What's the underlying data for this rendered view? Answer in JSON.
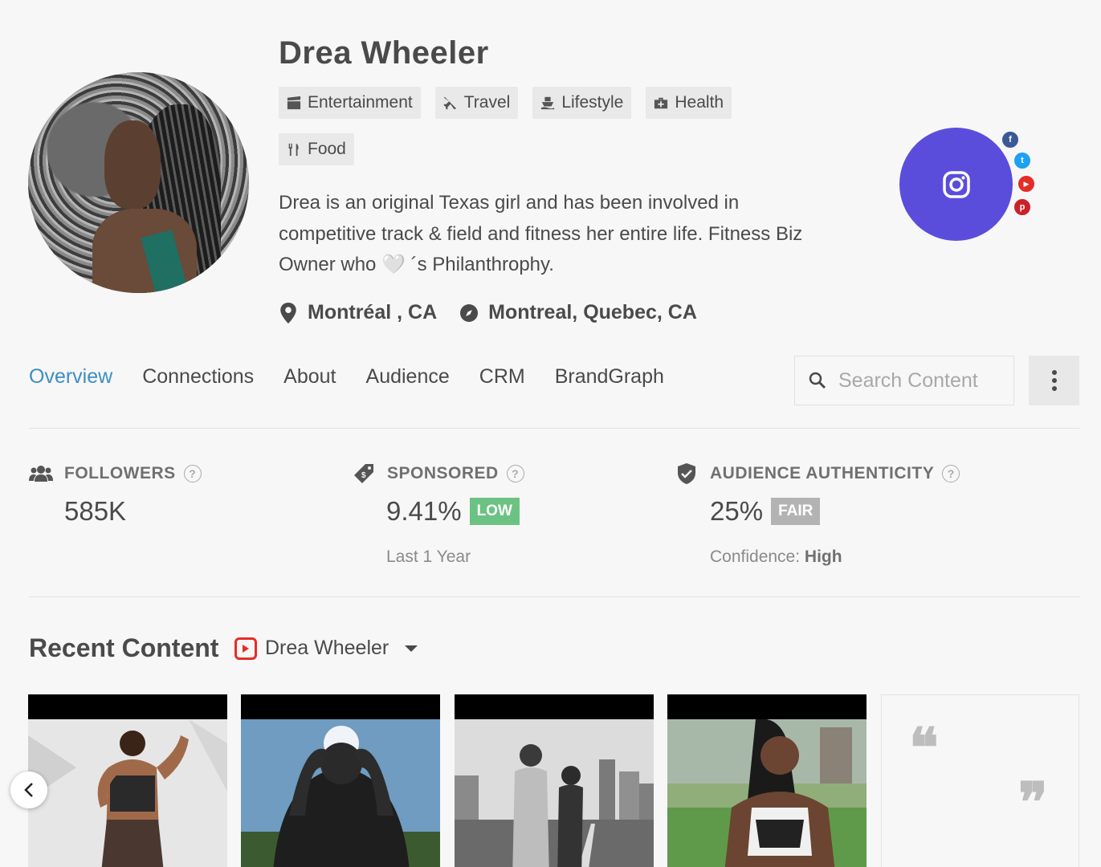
{
  "profile": {
    "name": "Drea Wheeler",
    "tags": [
      {
        "label": "Entertainment",
        "icon": "clapperboard-icon"
      },
      {
        "label": "Travel",
        "icon": "plane-icon"
      },
      {
        "label": "Lifestyle",
        "icon": "ship-icon"
      },
      {
        "label": "Health",
        "icon": "medkit-icon"
      },
      {
        "label": "Food",
        "icon": "utensils-icon"
      }
    ],
    "bio": "Drea is an original Texas girl and has been involved in competitive track & field and fitness her entire life. Fitness Biz Owner who 🤍 ´s Philanthrophy.",
    "location_primary": "Montréal , CA",
    "location_secondary": "Montreal, Quebec, CA"
  },
  "platforms": {
    "main": "instagram-icon",
    "main_color": "#5b4ddb",
    "others": [
      {
        "name": "facebook-icon",
        "glyph": "f",
        "color": "#3b5998"
      },
      {
        "name": "twitter-icon",
        "glyph": "t",
        "color": "#1da1f2"
      },
      {
        "name": "youtube-icon",
        "glyph": "▶",
        "color": "#e52d27"
      },
      {
        "name": "pinterest-icon",
        "glyph": "p",
        "color": "#cb2027"
      }
    ]
  },
  "nav": {
    "tabs": [
      "Overview",
      "Connections",
      "About",
      "Audience",
      "CRM",
      "BrandGraph"
    ],
    "active": "Overview",
    "active_color": "#3d8ec4"
  },
  "search": {
    "placeholder": "Search Content"
  },
  "stats": {
    "followers": {
      "label": "FOLLOWERS",
      "value": "585K"
    },
    "sponsored": {
      "label": "SPONSORED",
      "value": "9.41%",
      "badge": "LOW",
      "badge_color": "#6cc283",
      "sub": "Last 1 Year"
    },
    "authenticity": {
      "label": "AUDIENCE AUTHENTICITY",
      "value": "25%",
      "badge": "FAIR",
      "badge_color": "#b3b3b3",
      "sub_label": "Confidence:",
      "sub_value": "High"
    }
  },
  "recent": {
    "title": "Recent Content",
    "source_name": "Drea Wheeler",
    "source_icon": "youtube-icon",
    "quote_open": "❝",
    "quote_close": "❞"
  }
}
